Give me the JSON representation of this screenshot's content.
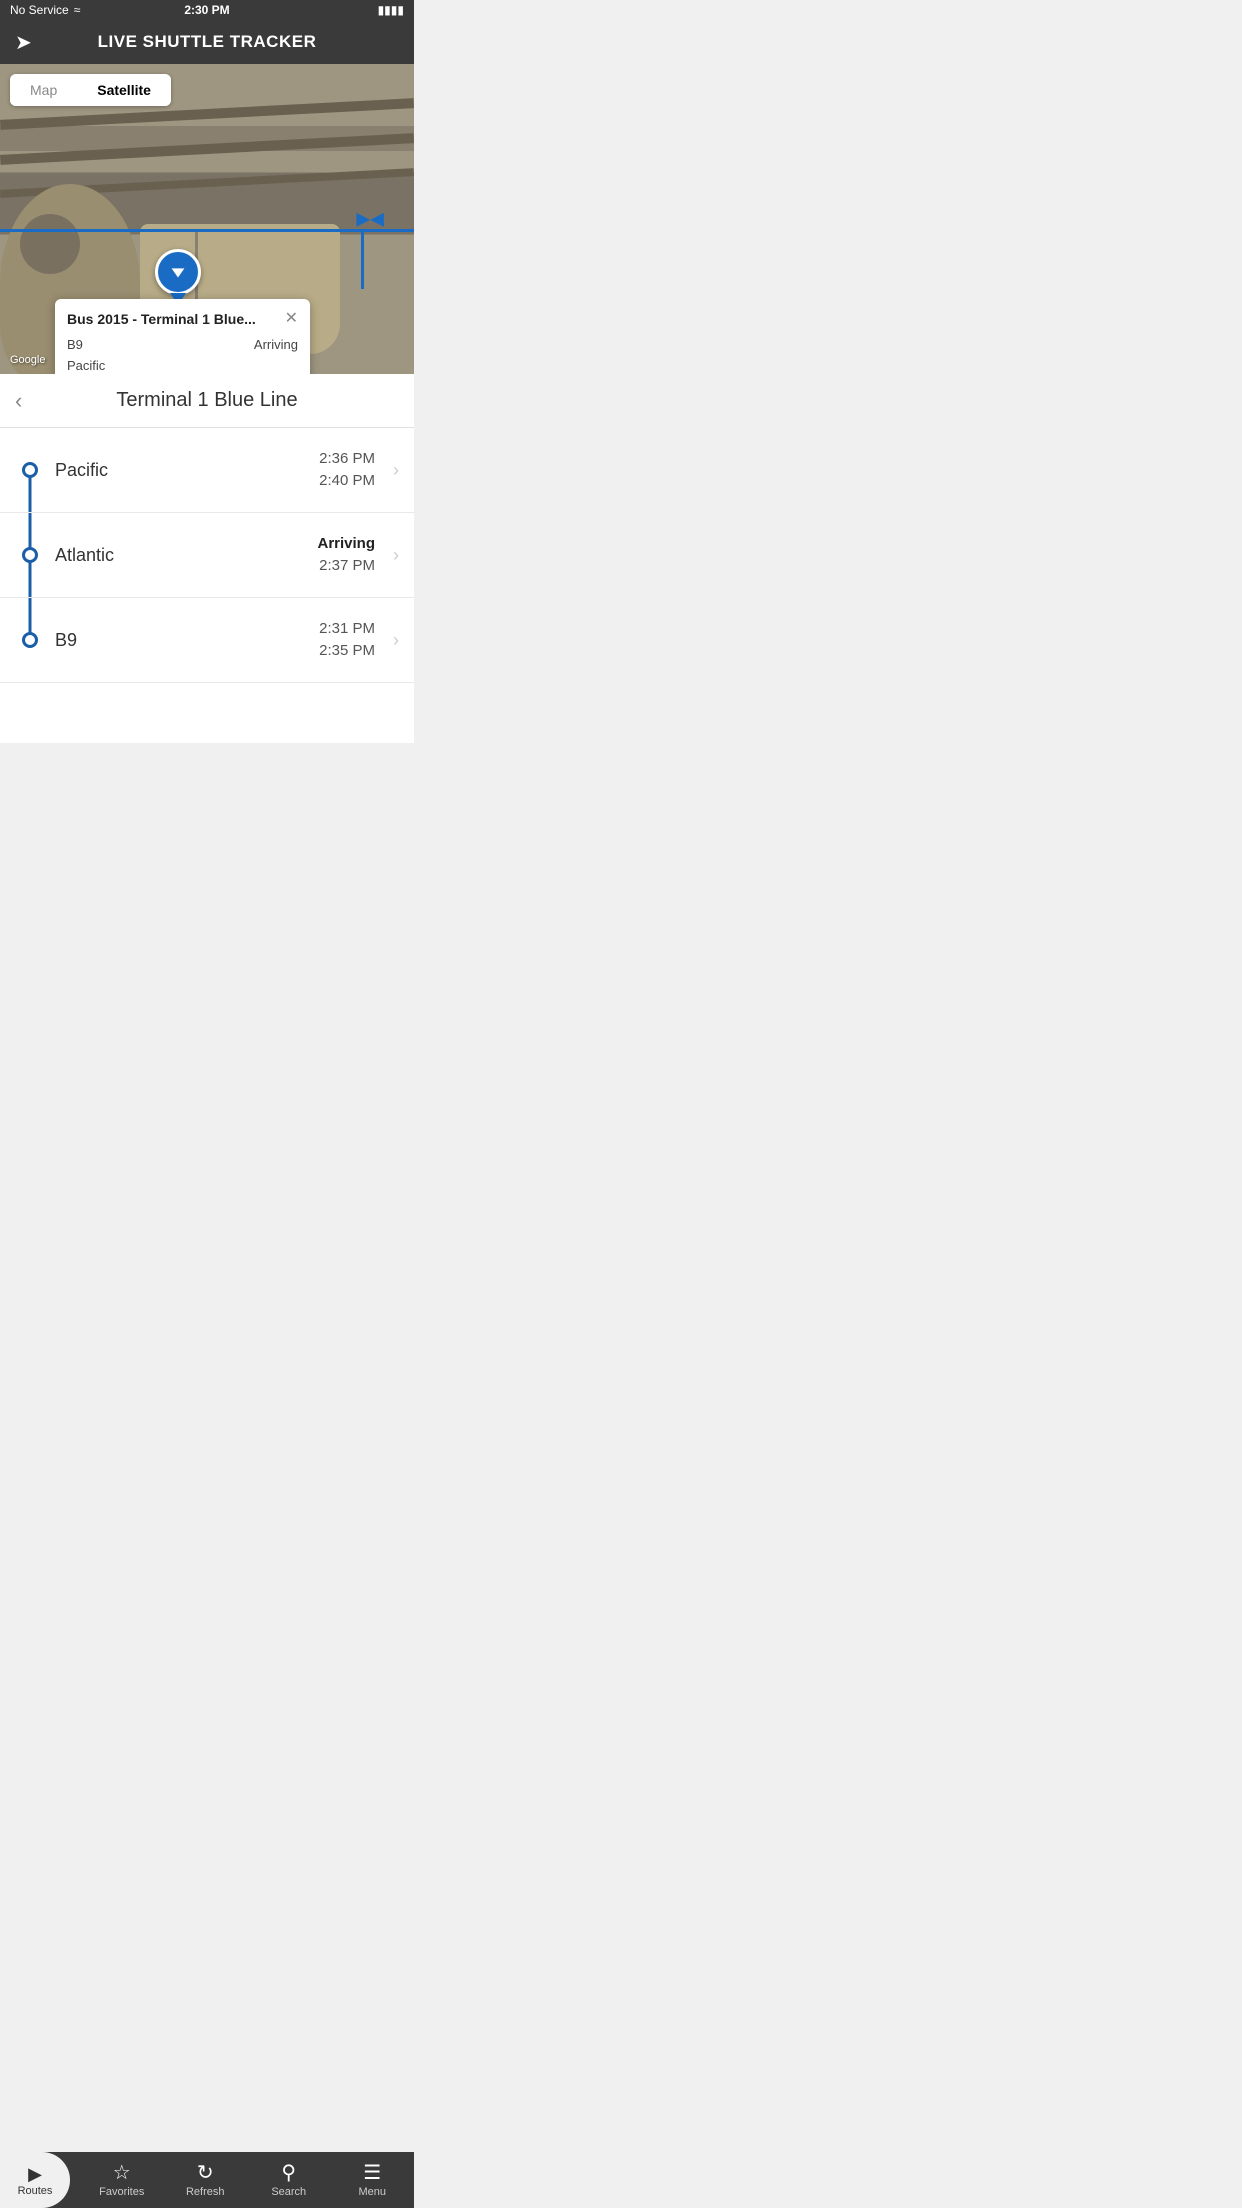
{
  "status_bar": {
    "carrier": "No Service",
    "time": "2:30 PM",
    "battery": "100%"
  },
  "header": {
    "title": "LIVE SHUTTLE TRACKER",
    "icon": "navigate"
  },
  "map": {
    "toggle": {
      "map_label": "Map",
      "satellite_label": "Satellite",
      "active": "satellite"
    },
    "google_label": "Google",
    "popup": {
      "title": "Bus 2015 - Terminal 1 Blue...",
      "row1_left": "B9",
      "row1_right": "Arriving",
      "row2_left": "Pacific",
      "row2_right": ""
    }
  },
  "route": {
    "title": "Terminal 1 Blue Line",
    "stops": [
      {
        "name": "Pacific",
        "time1": "2:36 PM",
        "time2": "2:40 PM",
        "status": ""
      },
      {
        "name": "Atlantic",
        "time1": "Arriving",
        "time2": "2:37 PM",
        "status": "arriving"
      },
      {
        "name": "B9",
        "time1": "2:31 PM",
        "time2": "2:35 PM",
        "status": ""
      }
    ]
  },
  "tab_bar": {
    "routes_label": "Routes",
    "favorites_label": "Favorites",
    "refresh_label": "Refresh",
    "search_label": "Search",
    "menu_label": "Menu"
  }
}
